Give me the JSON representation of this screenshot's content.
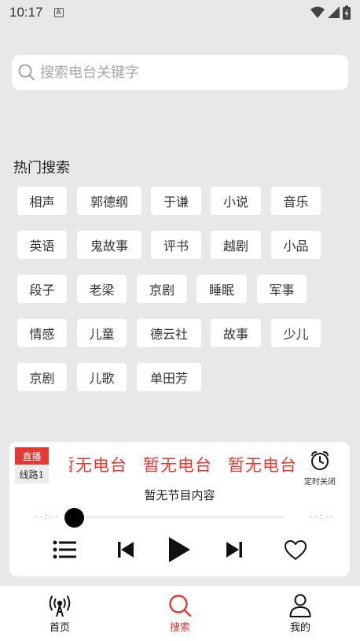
{
  "status": {
    "time": "10:17",
    "notification_glyph": "A"
  },
  "search": {
    "placeholder": "搜索电台关键字"
  },
  "hot": {
    "title": "热门搜索",
    "tags": [
      "相声",
      "郭德纲",
      "于谦",
      "小说",
      "音乐",
      "英语",
      "鬼故事",
      "评书",
      "越剧",
      "小品",
      "段子",
      "老梁",
      "京剧",
      "睡眠",
      "军事",
      "情感",
      "儿童",
      "德云社",
      "故事",
      "少儿",
      "京剧",
      "儿歌",
      "单田芳"
    ]
  },
  "player": {
    "live_badge": "直播",
    "line_badge": "线路1",
    "marquee": [
      "暂无电台",
      "暂无电台",
      "暂无电台"
    ],
    "timer_label": "定时关闭",
    "program": "暂无节目内容",
    "time_start": "--:--",
    "time_end": "--:--",
    "progress": 0
  },
  "nav": {
    "home": "首页",
    "search": "搜索",
    "mine": "我的"
  },
  "colors": {
    "accent": "#e53935",
    "background": "#e8e8e8",
    "card": "#ffffff"
  }
}
